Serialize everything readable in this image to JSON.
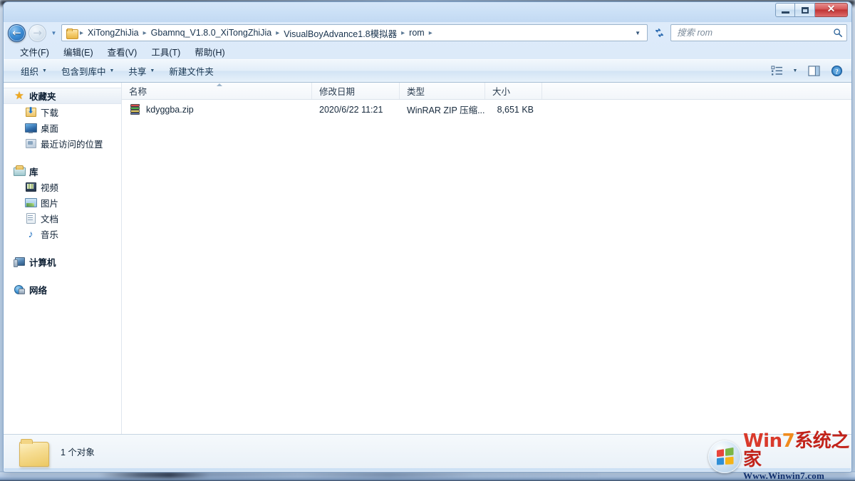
{
  "window": {
    "title": "",
    "controls": {
      "minimize_label": "最小化",
      "maximize_label": "最大化",
      "close_label": "关闭"
    }
  },
  "address_bar": {
    "back_label": "后退",
    "forward_label": "前进",
    "history_label": "最近访问的位置",
    "folder_icon": "folder-icon",
    "breadcrumbs": [
      "XiTongZhiJia",
      "Gbamnq_V1.8.0_XiTongZhiJia",
      "VisualBoyAdvance1.8模拟器",
      "rom"
    ],
    "separator": "▸",
    "dropdown_label": "▼",
    "refresh_label": "刷新"
  },
  "search": {
    "placeholder": "搜索 rom",
    "value": "",
    "icon": "search-icon"
  },
  "menu_bar": {
    "items": [
      {
        "label": "文件(F)",
        "name": "file"
      },
      {
        "label": "编辑(E)",
        "name": "edit"
      },
      {
        "label": "查看(V)",
        "name": "view"
      },
      {
        "label": "工具(T)",
        "name": "tools"
      },
      {
        "label": "帮助(H)",
        "name": "help"
      }
    ]
  },
  "command_bar": {
    "items": [
      {
        "label": "组织",
        "name": "organize",
        "has_caret": true
      },
      {
        "label": "包含到库中",
        "name": "include-in-library",
        "has_caret": true
      },
      {
        "label": "共享",
        "name": "share",
        "has_caret": true
      },
      {
        "label": "新建文件夹",
        "name": "new-folder",
        "has_caret": false
      }
    ],
    "caret": "▼",
    "view_options_label": "更改您的视图",
    "preview_pane_label": "显示预览窗格",
    "help_label": "获取帮助"
  },
  "nav_pane": {
    "groups": [
      {
        "root": {
          "label": "收藏夹",
          "icon": "star-icon",
          "name": "favorites",
          "selected": true
        },
        "children": [
          {
            "label": "下载",
            "icon": "download-icon",
            "name": "downloads"
          },
          {
            "label": "桌面",
            "icon": "desktop-icon",
            "name": "desktop"
          },
          {
            "label": "最近访问的位置",
            "icon": "recent-places-icon",
            "name": "recent-places"
          }
        ]
      },
      {
        "root": {
          "label": "库",
          "icon": "library-icon",
          "name": "libraries",
          "selected": false
        },
        "children": [
          {
            "label": "视频",
            "icon": "video-icon",
            "name": "videos"
          },
          {
            "label": "图片",
            "icon": "picture-icon",
            "name": "pictures"
          },
          {
            "label": "文档",
            "icon": "document-icon",
            "name": "documents"
          },
          {
            "label": "音乐",
            "icon": "music-icon",
            "name": "music"
          }
        ]
      },
      {
        "root": {
          "label": "计算机",
          "icon": "computer-icon",
          "name": "computer",
          "selected": false
        },
        "children": []
      },
      {
        "root": {
          "label": "网络",
          "icon": "network-icon",
          "name": "network",
          "selected": false
        },
        "children": []
      }
    ]
  },
  "file_list": {
    "columns": [
      {
        "label": "名称",
        "name": "name",
        "sorted": true,
        "sort_direction": "asc"
      },
      {
        "label": "修改日期",
        "name": "date-modified",
        "sorted": false
      },
      {
        "label": "类型",
        "name": "type",
        "sorted": false
      },
      {
        "label": "大小",
        "name": "size",
        "sorted": false
      }
    ],
    "rows": [
      {
        "name": "kdyggba.zip",
        "icon": "winrar-zip-icon",
        "date_modified": "2020/6/22 11:21",
        "type": "WinRAR ZIP 压缩...",
        "size": "8,651 KB"
      }
    ]
  },
  "status_bar": {
    "folder_icon": "folder-icon-large",
    "text": "1 个对象"
  },
  "watermark": {
    "logo": "windows-logo-icon",
    "title_win": "Win",
    "title_seven": "7",
    "title_cn": "系统之家",
    "url": "Www.Winwin7.com"
  },
  "colors": {
    "accent": "#2a6ab0",
    "close_button": "#c03434",
    "title_gradient_top": "#d5e6f8",
    "brand_red": "#d93a2b",
    "brand_orange": "#f08b1d"
  }
}
